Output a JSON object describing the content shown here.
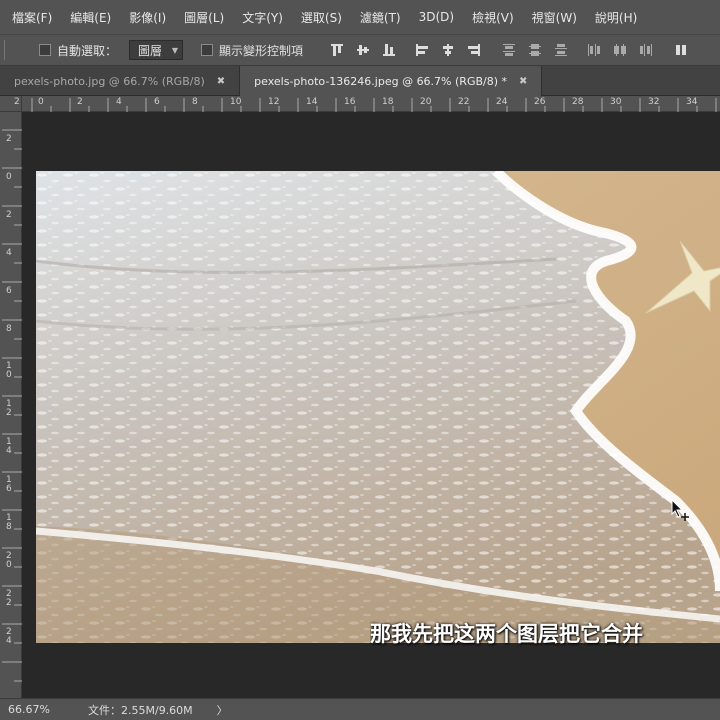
{
  "menu": [
    "檔案(F)",
    "編輯(E)",
    "影像(I)",
    "圖層(L)",
    "文字(Y)",
    "選取(S)",
    "濾鏡(T)",
    "3D(D)",
    "檢視(V)",
    "視窗(W)",
    "說明(H)"
  ],
  "options": {
    "auto_select_label": "自動選取：",
    "auto_select_value": "圖層",
    "show_transform_label": "顯示變形控制項"
  },
  "tabs": [
    {
      "label": "pexels-photo.jpg @ 66.7% (RGB/8)",
      "close": "✖"
    },
    {
      "label": "pexels-photo-136246.jpeg @ 66.7% (RGB/8) *",
      "close": "✖"
    }
  ],
  "ruler_h": [
    "2",
    "0",
    "2",
    "4",
    "6",
    "8",
    "10",
    "12",
    "14",
    "16",
    "18",
    "20",
    "22",
    "24",
    "26",
    "28",
    "30",
    "32",
    "34"
  ],
  "ruler_v": [
    "2",
    "0",
    "2",
    "4",
    "6",
    "8",
    "10",
    "12",
    "14",
    "16",
    "18",
    "20",
    "22",
    "24"
  ],
  "subtitle": "那我先把这两个图层把它合并",
  "status": {
    "zoom": "66.67%",
    "doc_size": "文件：2.55M/9.60M",
    "arrow": "〉"
  }
}
